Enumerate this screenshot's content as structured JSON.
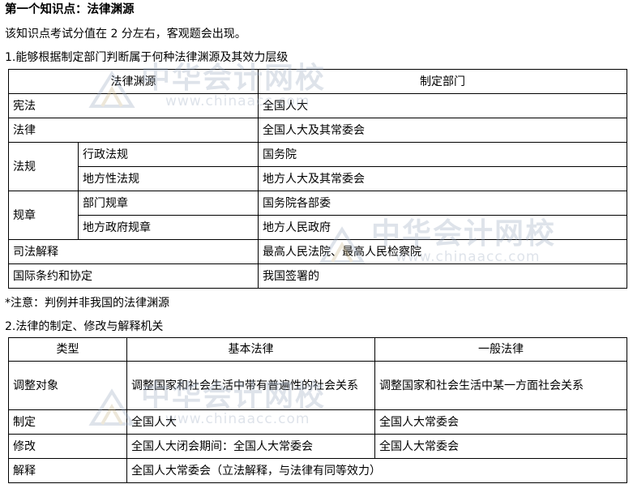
{
  "heading": {
    "title": "第一个知识点：法律渊源",
    "description": "该知识点考试分值在 2 分左右，客观题会出现。",
    "section1": "1.能够根据制定部门判断属于何种法律渊源及其效力层级",
    "note": "*注意：判例并非我国的法律渊源",
    "section2": "2.法律的制定、修改与解释机关"
  },
  "table1": {
    "headers": [
      "法律渊源",
      "制定部门"
    ],
    "rows": {
      "constitution": {
        "source": "宪法",
        "dept": "全国人大"
      },
      "law": {
        "source": "法律",
        "dept": "全国人大及其常委会"
      },
      "regulation": {
        "group": "法规",
        "admin": {
          "source": "行政法规",
          "dept": "国务院"
        },
        "local": {
          "source": "地方性法规",
          "dept": "地方人大及其常委会"
        }
      },
      "rule": {
        "group": "规章",
        "dept_rule": {
          "source": "部门规章",
          "dept": "国务院各部委"
        },
        "local_rule": {
          "source": "地方政府规章",
          "dept": "地方人民政府"
        }
      },
      "judicial": {
        "source": "司法解释",
        "dept": "最高人民法院、最高人民检察院"
      },
      "treaty": {
        "source": "国际条约和协定",
        "dept": "我国签署的"
      }
    }
  },
  "table2": {
    "headers": [
      "类型",
      "基本法律",
      "一般法律"
    ],
    "rows": {
      "scope": {
        "type": "调整对象",
        "basic": "调整国家和社会生活中带有普遍性的社会关系",
        "general": "调整国家和社会生活中某一方面社会关系"
      },
      "enact": {
        "type": "制定",
        "basic": "全国人大",
        "general": "全国人大常委会"
      },
      "amend": {
        "type": "修改",
        "basic": "全国人大闭会期间：全国人大常委会",
        "general": "全国人大常委会"
      },
      "interpret": {
        "type": "解释",
        "basic": "全国人大常委会（立法解释，与法律有同等效力）"
      }
    }
  },
  "watermark": {
    "brand": "中华会计网校",
    "url": "www.chinaacc.com",
    "color": "#9aa9bf"
  }
}
